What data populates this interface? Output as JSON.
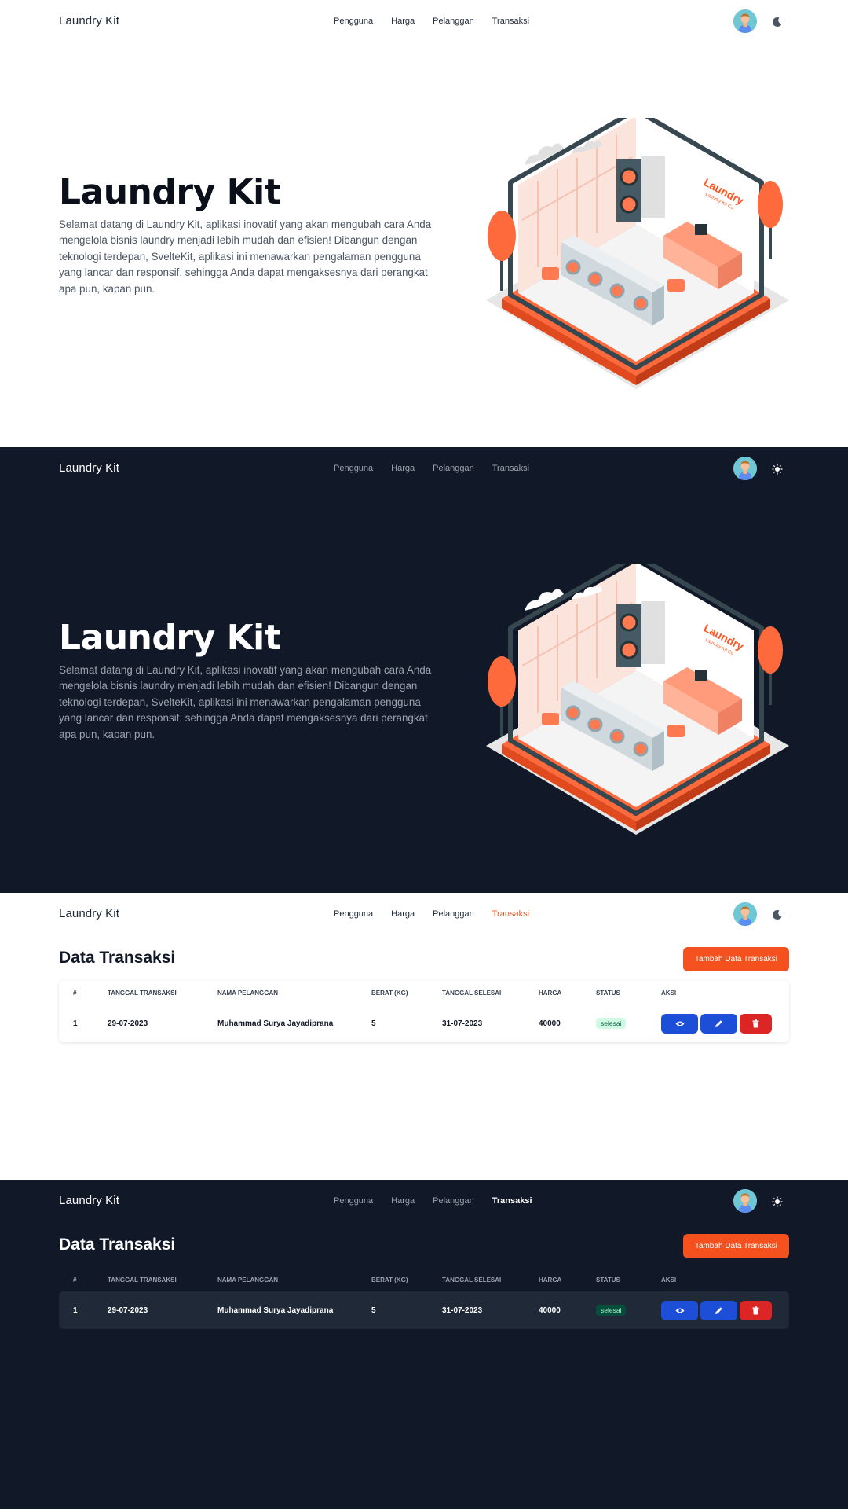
{
  "app": {
    "brand": "Laundry Kit"
  },
  "nav": {
    "items": [
      "Pengguna",
      "Harga",
      "Pelanggan",
      "Transaksi"
    ],
    "avatar_icon": "user-avatar-icon",
    "light_toggle_icon": "moon-icon",
    "dark_toggle_icon": "sun-icon"
  },
  "hero": {
    "title": "Laundry Kit",
    "description": "Selamat datang di Laundry Kit, aplikasi inovatif yang akan mengubah cara Anda mengelola bisnis laundry menjadi lebih mudah dan efisien! Dibangun dengan teknologi terdepan, SvelteKit, aplikasi ini menawarkan pengalaman pengguna yang lancar dan responsif, sehingga Anda dapat mengaksesnya dari perangkat apa pun, kapan pun.",
    "illustration_sign": "Laundry",
    "illustration_sign_sub": "Laundry Kit Co."
  },
  "transactions": {
    "title": "Data Transaksi",
    "add_button": "Tambah Data Transaksi",
    "columns": [
      "#",
      "Tanggal Transaksi",
      "Nama Pelanggan",
      "Berat (KG)",
      "Tanggal Selesai",
      "Harga",
      "Status",
      "Aksi"
    ],
    "rows": [
      {
        "no": "1",
        "tanggal_transaksi": "29-07-2023",
        "nama_pelanggan": "Muhammad Surya Jayadiprana",
        "berat": "5",
        "tanggal_selesai": "31-07-2023",
        "harga": "40000",
        "status": "selesai"
      }
    ],
    "action_icons": [
      "eye-icon",
      "pencil-icon",
      "trash-icon"
    ]
  },
  "colors": {
    "accent": "#f4511e",
    "dark_bg": "#111827",
    "dark_row": "#1f2937",
    "action_blue": "#1d4ed8",
    "action_red": "#dc2626"
  }
}
